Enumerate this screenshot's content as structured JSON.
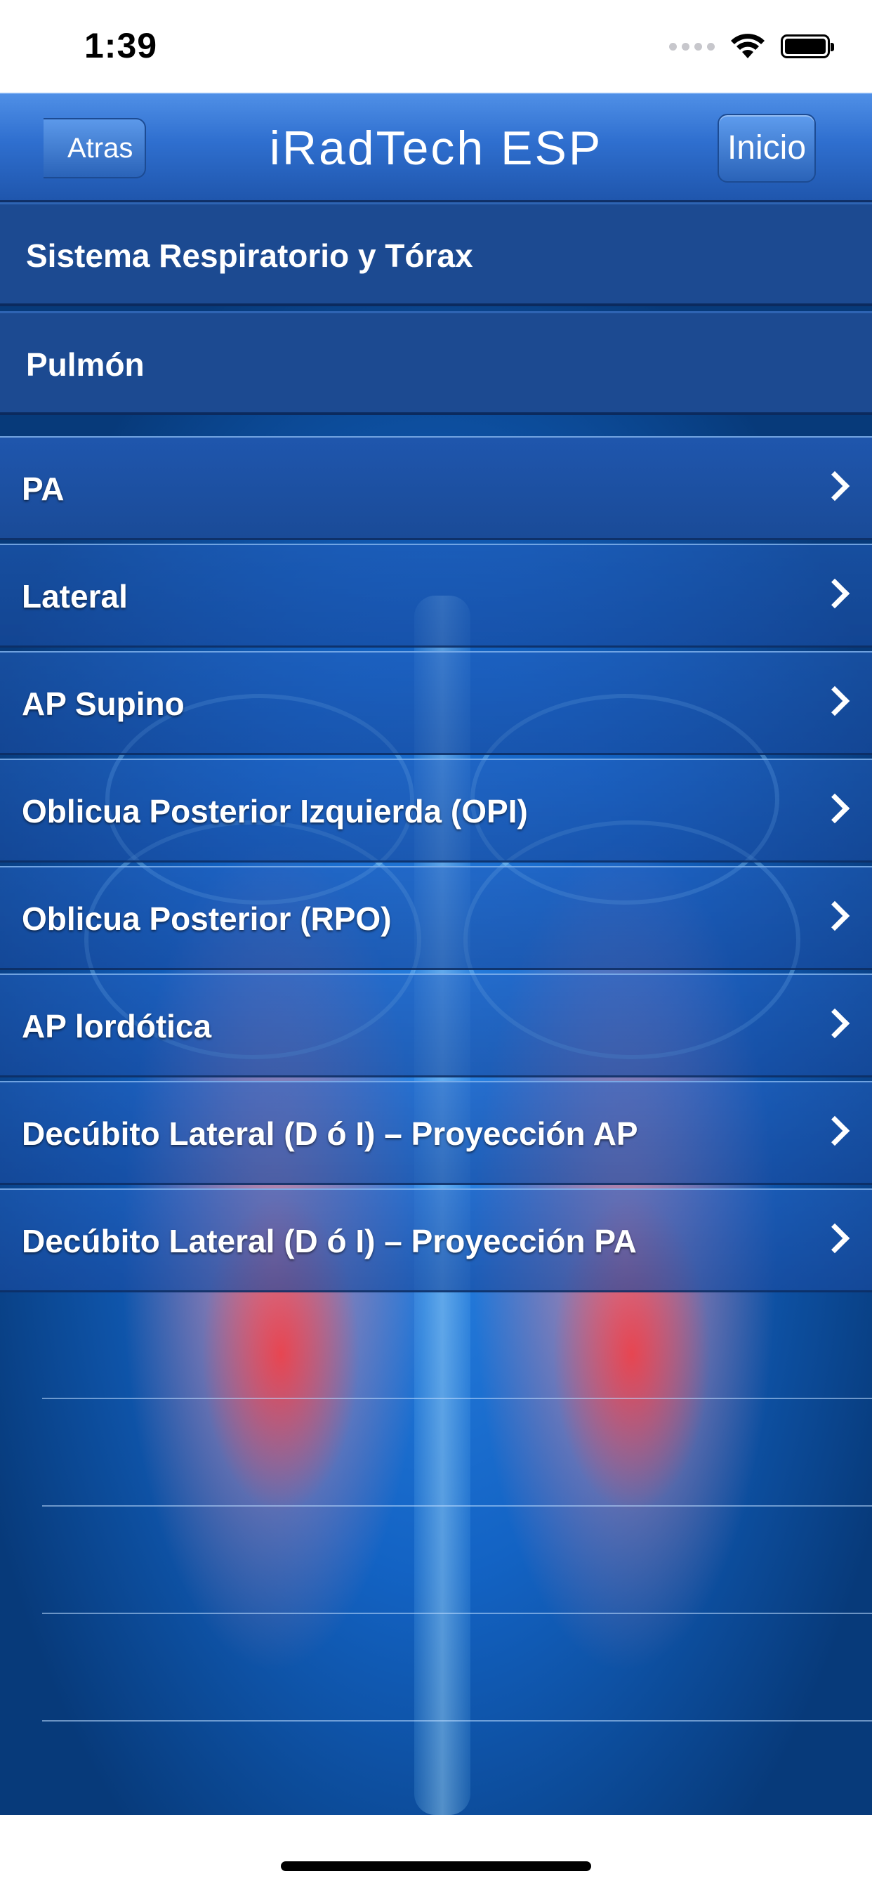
{
  "status_bar": {
    "time": "1:39"
  },
  "nav": {
    "title": "iRadTech ESP",
    "back_label": "Atras",
    "home_label": "Inicio"
  },
  "section_headers": [
    "Sistema Respiratorio y Tórax",
    "Pulmón"
  ],
  "menu_items": [
    "PA",
    "Lateral",
    "AP Supino",
    "Oblicua Posterior Izquierda (OPI)",
    "Oblicua Posterior (RPO)",
    "AP lordótica",
    "Decúbito Lateral (D ó I) – Proyección AP",
    "Decúbito Lateral (D ó I) – Proyección PA"
  ],
  "colors": {
    "nav_blue": "#2f6fcf",
    "header_blue": "#1c4a91",
    "lung_red": "#ff3232"
  },
  "icons": [
    "wifi-icon",
    "battery-icon",
    "back-arrow-icon",
    "chevron-right-icon"
  ]
}
